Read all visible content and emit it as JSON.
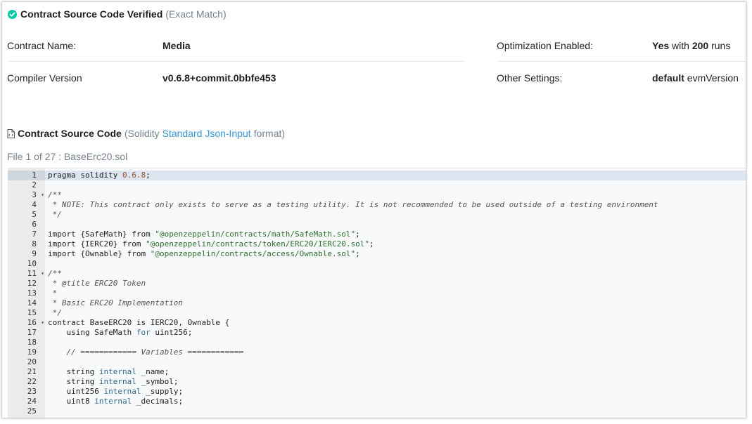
{
  "verified": {
    "title": "Contract Source Code Verified",
    "subtitle": "(Exact Match)"
  },
  "info": {
    "contract_name_label": "Contract Name:",
    "contract_name_value": "Media",
    "compiler_label": "Compiler Version",
    "compiler_value": "v0.6.8+commit.0bbfe453",
    "optimization_label": "Optimization Enabled:",
    "optimization_value": "Yes",
    "optimization_with": "with",
    "optimization_runs": "200",
    "optimization_runs_suffix": "runs",
    "other_label": "Other Settings:",
    "other_value": "default",
    "other_suffix": "evmVersion"
  },
  "source": {
    "title": "Contract Source Code",
    "paren_open": "(Solidity",
    "link": "Standard Json-Input",
    "paren_close": "format)",
    "file_line": "File 1 of 27 : BaseErc20.sol"
  },
  "colors": {
    "accent_green": "#00c9a7",
    "link_blue": "#3498db",
    "active_line": "#dde6f0"
  },
  "icons": {
    "verified": "check-circle-icon",
    "source": "file-code-icon",
    "fold": "fold-arrow-icon"
  },
  "code_lines": [
    {
      "n": "1",
      "fold": "",
      "active": true,
      "tokens": [
        {
          "t": "pragma solidity ",
          "c": "plain"
        },
        {
          "t": "0.6.8",
          "c": "num"
        },
        {
          "t": ";",
          "c": "plain"
        }
      ]
    },
    {
      "n": "2",
      "fold": "",
      "tokens": []
    },
    {
      "n": "3",
      "fold": "▾",
      "tokens": [
        {
          "t": "/**",
          "c": "cm"
        }
      ]
    },
    {
      "n": "4",
      "fold": "",
      "tokens": [
        {
          "t": " * NOTE: This contract only exists to serve as a testing utility. It is not recommended to be used outside of a testing environment",
          "c": "cm"
        }
      ]
    },
    {
      "n": "5",
      "fold": "",
      "tokens": [
        {
          "t": " */",
          "c": "cm"
        }
      ]
    },
    {
      "n": "6",
      "fold": "",
      "tokens": []
    },
    {
      "n": "7",
      "fold": "",
      "tokens": [
        {
          "t": "import {SafeMath} from ",
          "c": "plain"
        },
        {
          "t": "\"@openzeppelin/contracts/math/SafeMath.sol\"",
          "c": "str"
        },
        {
          "t": ";",
          "c": "plain"
        }
      ]
    },
    {
      "n": "8",
      "fold": "",
      "tokens": [
        {
          "t": "import {IERC20} from ",
          "c": "plain"
        },
        {
          "t": "\"@openzeppelin/contracts/token/ERC20/IERC20.sol\"",
          "c": "str"
        },
        {
          "t": ";",
          "c": "plain"
        }
      ]
    },
    {
      "n": "9",
      "fold": "",
      "tokens": [
        {
          "t": "import {Ownable} from ",
          "c": "plain"
        },
        {
          "t": "\"@openzeppelin/contracts/access/Ownable.sol\"",
          "c": "str"
        },
        {
          "t": ";",
          "c": "plain"
        }
      ]
    },
    {
      "n": "10",
      "fold": "",
      "tokens": []
    },
    {
      "n": "11",
      "fold": "▾",
      "tokens": [
        {
          "t": "/**",
          "c": "cm"
        }
      ]
    },
    {
      "n": "12",
      "fold": "",
      "tokens": [
        {
          "t": " * @title ERC20 Token",
          "c": "cm"
        }
      ]
    },
    {
      "n": "13",
      "fold": "",
      "tokens": [
        {
          "t": " *",
          "c": "cm"
        }
      ]
    },
    {
      "n": "14",
      "fold": "",
      "tokens": [
        {
          "t": " * Basic ERC20 Implementation",
          "c": "cm"
        }
      ]
    },
    {
      "n": "15",
      "fold": "",
      "tokens": [
        {
          "t": " */",
          "c": "cm"
        }
      ]
    },
    {
      "n": "16",
      "fold": "▾",
      "tokens": [
        {
          "t": "contract BaseERC20 is IERC20, Ownable {",
          "c": "plain"
        }
      ]
    },
    {
      "n": "17",
      "fold": "",
      "tokens": [
        {
          "t": "    using SafeMath ",
          "c": "plain"
        },
        {
          "t": "for",
          "c": "kw"
        },
        {
          "t": " uint256;",
          "c": "plain"
        }
      ]
    },
    {
      "n": "18",
      "fold": "",
      "tokens": []
    },
    {
      "n": "19",
      "fold": "",
      "tokens": [
        {
          "t": "    // ============ Variables ============",
          "c": "cm"
        }
      ]
    },
    {
      "n": "20",
      "fold": "",
      "tokens": []
    },
    {
      "n": "21",
      "fold": "",
      "tokens": [
        {
          "t": "    string ",
          "c": "plain"
        },
        {
          "t": "internal",
          "c": "kw"
        },
        {
          "t": " _name;",
          "c": "plain"
        }
      ]
    },
    {
      "n": "22",
      "fold": "",
      "tokens": [
        {
          "t": "    string ",
          "c": "plain"
        },
        {
          "t": "internal",
          "c": "kw"
        },
        {
          "t": " _symbol;",
          "c": "plain"
        }
      ]
    },
    {
      "n": "23",
      "fold": "",
      "tokens": [
        {
          "t": "    uint256 ",
          "c": "plain"
        },
        {
          "t": "internal",
          "c": "kw"
        },
        {
          "t": " _supply;",
          "c": "plain"
        }
      ]
    },
    {
      "n": "24",
      "fold": "",
      "tokens": [
        {
          "t": "    uint8 ",
          "c": "plain"
        },
        {
          "t": "internal",
          "c": "kw"
        },
        {
          "t": " _decimals;",
          "c": "plain"
        }
      ]
    },
    {
      "n": "25",
      "fold": "",
      "tokens": []
    }
  ]
}
